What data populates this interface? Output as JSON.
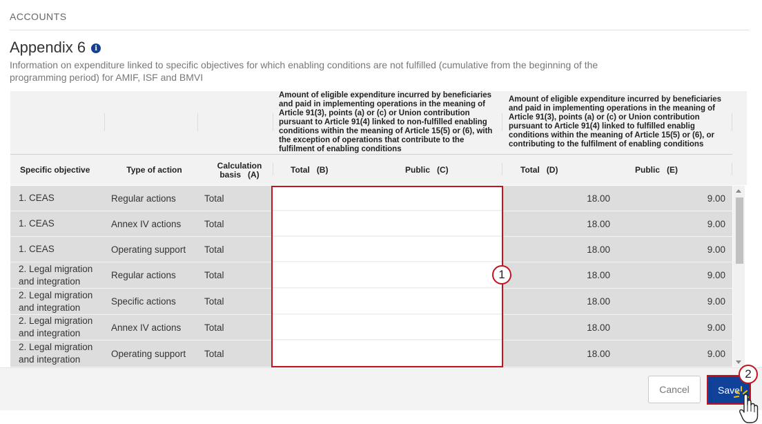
{
  "section": {
    "label": "ACCOUNTS"
  },
  "page": {
    "title": "Appendix 6",
    "description": "Information on expenditure linked to specific objectives for which enabling conditions are not fulfilled (cumulative from the beginning of the programming period) for AMIF, ISF and BMVI"
  },
  "table": {
    "group_headers": {
      "non_fulfilled": "Amount of eligible expenditure incurred by beneficiaries and paid in implementing operations in the meaning of Article 91(3), points (a) or (c) or Union contribution pursuant to Article 91(4) linked to non-fulfilled enabling conditions within the meaning of Article 15(5) or (6), with the exception of operations that contribute to the fulfilment of enabling conditions",
      "fulfilled": "Amount of eligible expenditure incurred by beneficiaries and paid in implementing operations in the meaning of Article 91(3), points (a) or (c) or Union contribution pursuant to Article 91(4) linked to fulfilled enablig conditions within the meaning of Article 15(5) or (6), or contributing to the fulfilment of enabling conditions"
    },
    "columns": {
      "objective": "Specific objective",
      "type": "Type of action",
      "basis": "Calculation basis   (A)",
      "total_b": "Total   (B)",
      "public_c": "Public   (C)",
      "total_d": "Total   (D)",
      "public_e": "Public   (E)"
    },
    "rows": [
      {
        "objective": "1. CEAS",
        "type": "Regular actions",
        "basis": "Total",
        "total_b": "",
        "public_c": "",
        "total_d": "18.00",
        "public_e": "9.00"
      },
      {
        "objective": "1. CEAS",
        "type": "Annex IV actions",
        "basis": "Total",
        "total_b": "",
        "public_c": "",
        "total_d": "18.00",
        "public_e": "9.00"
      },
      {
        "objective": "1. CEAS",
        "type": "Operating support",
        "basis": "Total",
        "total_b": "",
        "public_c": "",
        "total_d": "18.00",
        "public_e": "9.00"
      },
      {
        "objective": "2. Legal migration and integration",
        "type": "Regular actions",
        "basis": "Total",
        "total_b": "",
        "public_c": "",
        "total_d": "18.00",
        "public_e": "9.00"
      },
      {
        "objective": "2. Legal migration and integration",
        "type": "Specific actions",
        "basis": "Total",
        "total_b": "",
        "public_c": "",
        "total_d": "18.00",
        "public_e": "9.00"
      },
      {
        "objective": "2. Legal migration and integration",
        "type": "Annex IV actions",
        "basis": "Total",
        "total_b": "",
        "public_c": "",
        "total_d": "18.00",
        "public_e": "9.00"
      },
      {
        "objective": "2. Legal migration and integration",
        "type": "Operating support",
        "basis": "Total",
        "total_b": "",
        "public_c": "",
        "total_d": "18.00",
        "public_e": "9.00"
      }
    ]
  },
  "buttons": {
    "cancel": "Cancel",
    "save": "Save"
  },
  "callouts": {
    "one": "1",
    "two": "2"
  },
  "icons": {
    "info": "info-icon",
    "cursor": "hand-pointer-icon"
  },
  "colors": {
    "accent": "#0f4199",
    "highlight": "#c0141e",
    "row_bg": "#dddddd"
  }
}
